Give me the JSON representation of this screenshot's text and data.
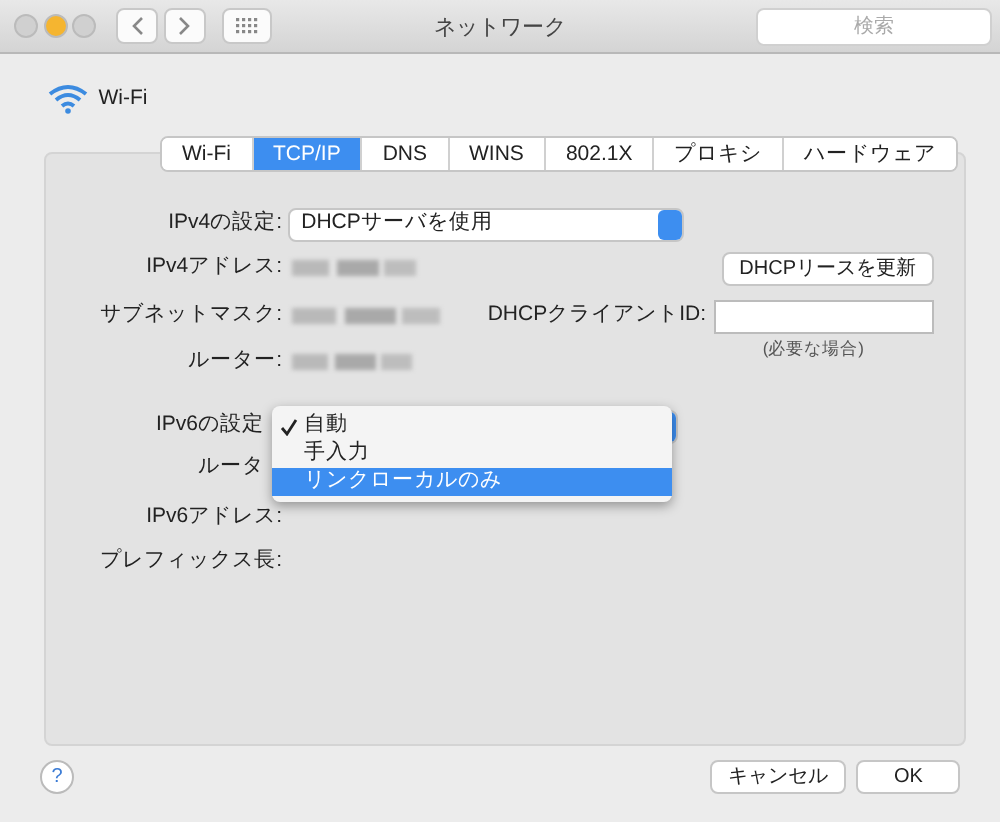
{
  "window": {
    "title": "ネットワーク",
    "search": {
      "placeholder": "検索"
    }
  },
  "service": {
    "name": "Wi-Fi"
  },
  "tabs": [
    {
      "label": "Wi-Fi",
      "selected": false
    },
    {
      "label": "TCP/IP",
      "selected": true
    },
    {
      "label": "DNS",
      "selected": false
    },
    {
      "label": "WINS",
      "selected": false
    },
    {
      "label": "802.1X",
      "selected": false
    },
    {
      "label": "プロキシ",
      "selected": false
    },
    {
      "label": "ハードウェア",
      "selected": false
    }
  ],
  "ipv4": {
    "config_label": "IPv4の設定:",
    "config_value": "DHCPサーバを使用",
    "address_label": "IPv4アドレス:",
    "subnet_label": "サブネットマスク:",
    "router_label": "ルーター:",
    "renew_button": "DHCPリースを更新",
    "client_id_label": "DHCPクライアントID:",
    "client_id_hint": "(必要な場合)"
  },
  "ipv6": {
    "config_label": "IPv6の設定",
    "router_label": "ルータ",
    "address_label": "IPv6アドレス:",
    "prefix_label": "プレフィックス長:"
  },
  "ipv6_menu": [
    {
      "label": "自動",
      "checked": true,
      "selected": false
    },
    {
      "label": "手入力",
      "checked": false,
      "selected": false
    },
    {
      "label": "リンクローカルのみ",
      "checked": false,
      "selected": true
    }
  ],
  "help": "?",
  "buttons": [
    "キャンセル",
    "OK"
  ]
}
